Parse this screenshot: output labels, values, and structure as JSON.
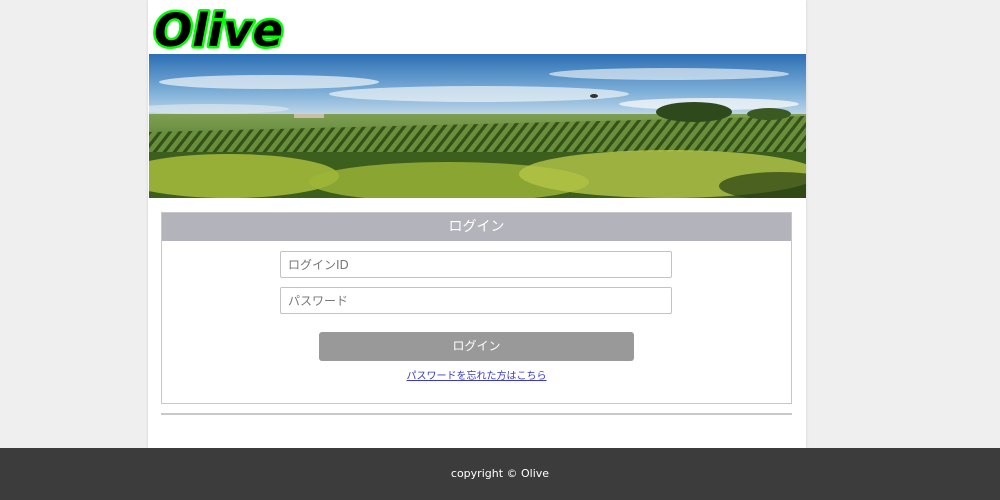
{
  "logo": {
    "text": "Olive",
    "fill_color": "#000000",
    "outline_color": "#00ff00"
  },
  "banner": {
    "description_icon": "vineyard-landscape-image"
  },
  "login": {
    "header_title": "ログイン",
    "id_placeholder": "ログインID",
    "password_placeholder": "パスワード",
    "submit_label": "ログイン",
    "forgot_link_label": "パスワードを忘れた方はこちら"
  },
  "footer": {
    "copyright": "copyright © Olive"
  },
  "colors": {
    "page_background": "#efefef",
    "header_bar": "#b3b4bb",
    "button": "#999999",
    "link": "#3a3ac4",
    "footer": "#3c3c3c"
  }
}
